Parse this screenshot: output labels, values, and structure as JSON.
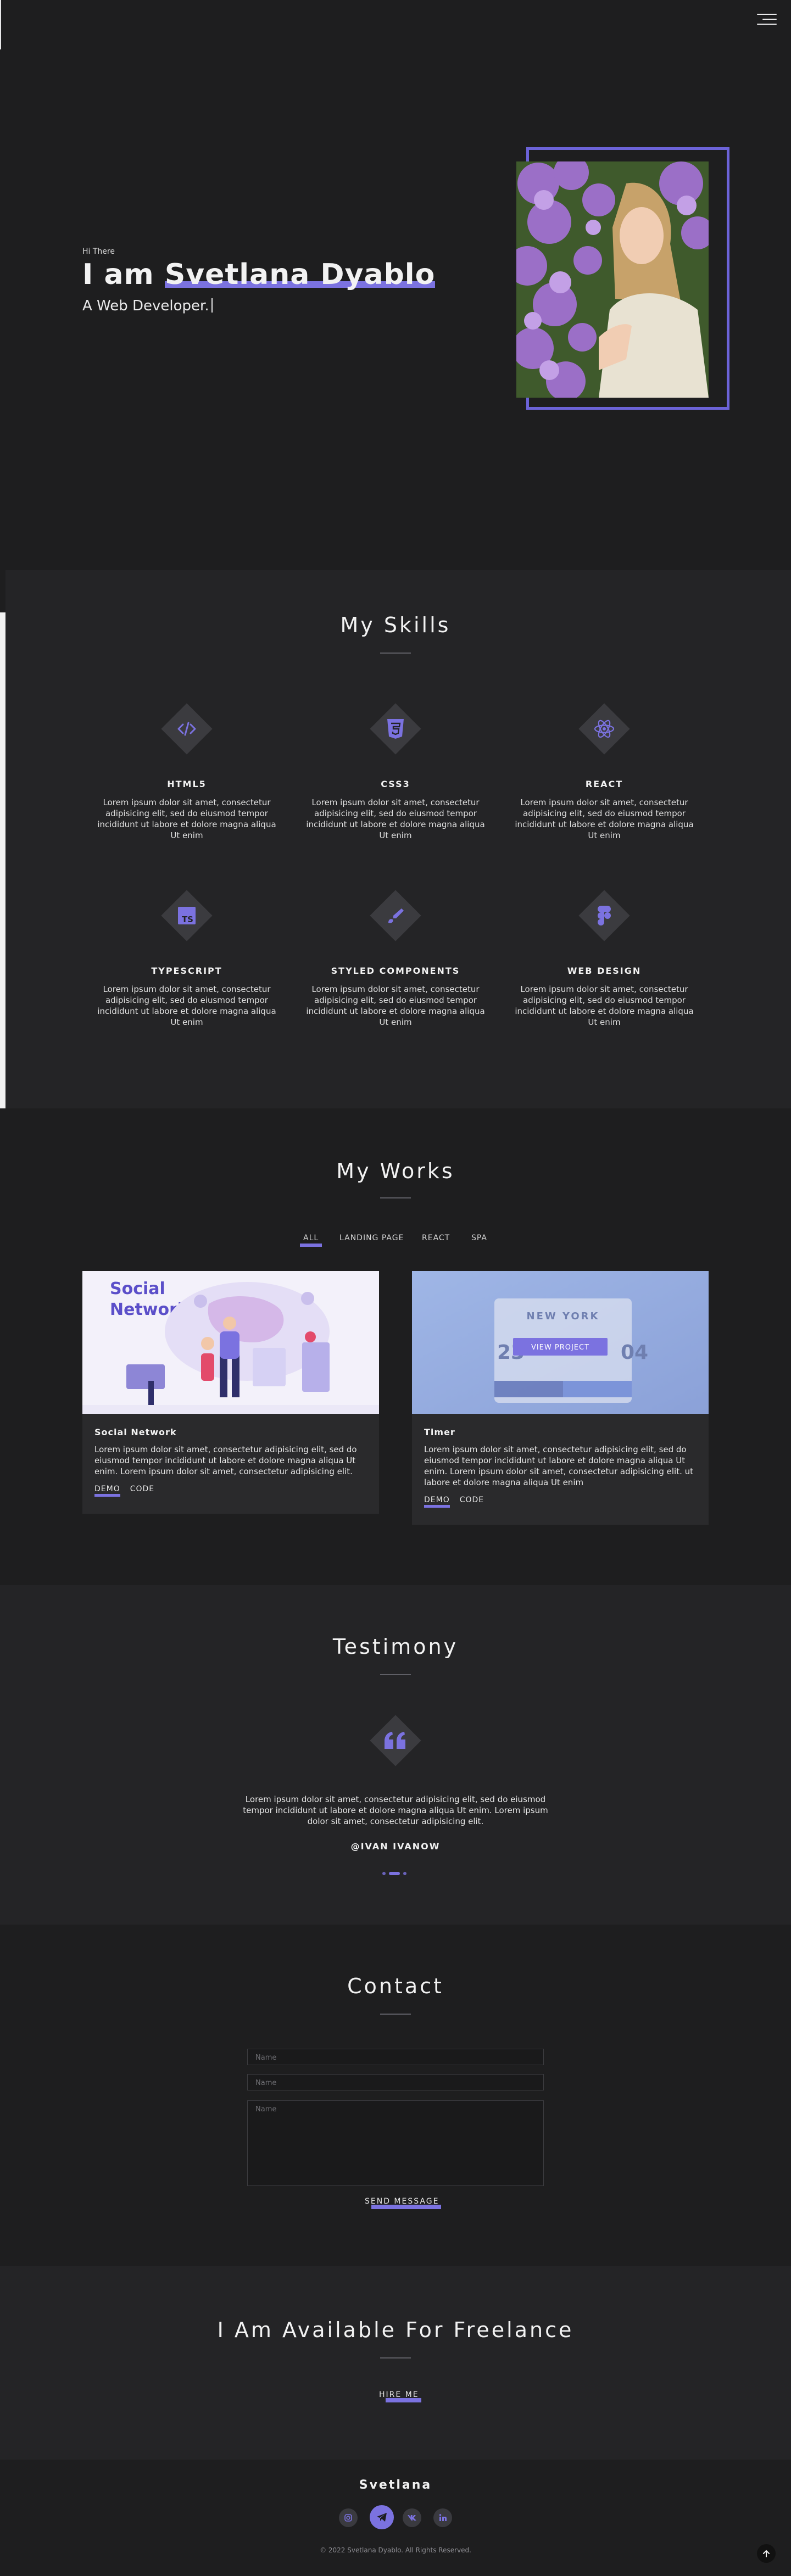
{
  "colors": {
    "accent": "#7b72e0",
    "background": "#1e1e1f",
    "section": "#242426"
  },
  "nav": {
    "menu_icon": "hamburger-menu-icon"
  },
  "hero": {
    "greeting": "Hi There",
    "name_prefix": "I am ",
    "name": "Svetlana Dyablo",
    "role": "A Web Developer."
  },
  "skills": {
    "title": "My Skills",
    "items": [
      {
        "name": "HTML5",
        "icon": "code-icon",
        "text": "Lorem ipsum dolor sit amet, consectetur adipisicing elit, sed do eiusmod tempor incididunt ut labore et dolore magna aliqua Ut enim"
      },
      {
        "name": "CSS3",
        "icon": "css3-icon",
        "text": "Lorem ipsum dolor sit amet, consectetur adipisicing elit, sed do eiusmod tempor incididunt ut labore et dolore magna aliqua Ut enim"
      },
      {
        "name": "REACT",
        "icon": "react-icon",
        "text": "Lorem ipsum dolor sit amet, consectetur adipisicing elit, sed do eiusmod tempor incididunt ut labore et dolore magna aliqua Ut enim"
      },
      {
        "name": "TYPESCRIPT",
        "icon": "typescript-icon",
        "text": "Lorem ipsum dolor sit amet, consectetur adipisicing elit, sed do eiusmod tempor incididunt ut labore et dolore magna aliqua Ut enim"
      },
      {
        "name": "STYLED COMPONENTS",
        "icon": "styled-components-icon",
        "text": "Lorem ipsum dolor sit amet, consectetur adipisicing elit, sed do eiusmod tempor incididunt ut labore et dolore magna aliqua Ut enim"
      },
      {
        "name": "WEB DESIGN",
        "icon": "figma-icon",
        "text": "Lorem ipsum dolor sit amet, consectetur adipisicing elit, sed do eiusmod tempor incididunt ut labore et dolore magna aliqua Ut enim"
      }
    ]
  },
  "works": {
    "title": "My Works",
    "filters": [
      "ALL",
      "LANDING PAGE",
      "REACT",
      "SPA"
    ],
    "cards": [
      {
        "title": "Social Network",
        "text": "Lorem ipsum dolor sit amet, consectetur adipisicing elit, sed do eiusmod tempor incididunt ut labore et dolore magna aliqua Ut enim. Lorem ipsum dolor sit amet, consectetur adipisicing elit.",
        "demo": "DEMO",
        "code": "CODE",
        "thumb_title_1": "Social",
        "thumb_title_2": "Network"
      },
      {
        "title": "Timer",
        "text": "Lorem ipsum dolor sit amet, consectetur adipisicing elit, sed do eiusmod tempor incididunt ut labore et dolore magna aliqua Ut enim. Lorem ipsum dolor sit amet, consectetur adipisicing elit. ut labore et dolore magna aliqua Ut enim",
        "demo": "DEMO",
        "code": "CODE",
        "overlay_button": "VIEW PROJECT",
        "thumb_city": "NEW YORK",
        "thumb_num_1": "23",
        "thumb_num_2": "04"
      }
    ]
  },
  "testimony": {
    "title": "Testimony",
    "quote": "Lorem ipsum dolor sit amet, consectetur adipisicing elit, sed do eiusmod tempor incididunt ut labore et dolore magna aliqua Ut enim. Lorem ipsum dolor sit amet, consectetur adipisicing elit.",
    "author": "@IVAN IVANOW",
    "slide_count": 3,
    "active_slide": 1
  },
  "contact": {
    "title": "Contact",
    "name_placeholder": "Name",
    "subject_placeholder": "Name",
    "message_placeholder": "Name",
    "submit": "SEND MESSAGE"
  },
  "freelance": {
    "title": "I Am Available For Freelance",
    "button": "HIRE ME"
  },
  "footer": {
    "name": "Svetlana",
    "socials": [
      "instagram-icon",
      "telegram-icon",
      "vk-icon",
      "linkedin-icon"
    ],
    "copyright": "© 2022 Svetlana Dyablo. All Rights Reserved."
  }
}
